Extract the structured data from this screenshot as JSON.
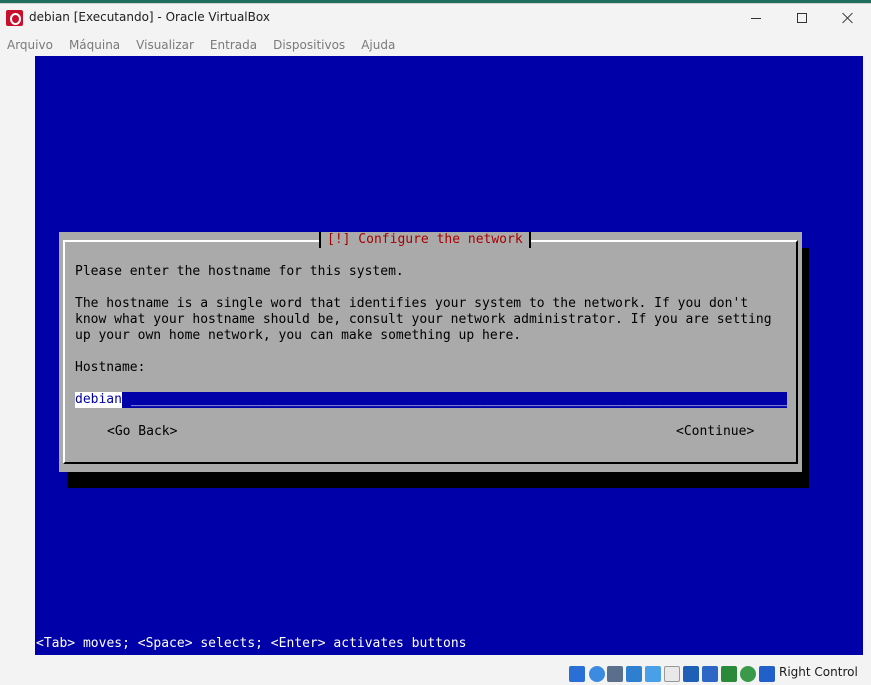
{
  "window": {
    "title": "debian [Executando] - Oracle VirtualBox"
  },
  "menu": [
    "Arquivo",
    "Máquina",
    "Visualizar",
    "Entrada",
    "Dispositivos",
    "Ajuda"
  ],
  "installer": {
    "dialog_title": "[!] Configure the network",
    "prompt": "Please enter the hostname for this system.",
    "description_lines": [
      "The hostname is a single word that identifies your system to the network. If you don't",
      "know what your hostname should be, consult your network administrator. If you are setting",
      "up your own home network, you can make something up here."
    ],
    "field_label": "Hostname:",
    "hostname_value": "debian",
    "go_back": "<Go Back>",
    "continue": "<Continue>",
    "help_line": "<Tab> moves; <Space> selects; <Enter> activates buttons"
  },
  "statusbar": {
    "host_key": "Right Control",
    "icons": [
      "hard-disk-icon",
      "optical-drive-icon",
      "audio-icon",
      "network-icon",
      "usb-icon",
      "shared-folders-icon",
      "display-icon",
      "video-capture-icon",
      "cpu-icon",
      "mouse-integration-icon",
      "keyboard-icon"
    ],
    "colors": {
      "screen_blue": "#0000a8",
      "dialog_gray": "#aaaaaa",
      "title_red": "#a80000"
    }
  }
}
